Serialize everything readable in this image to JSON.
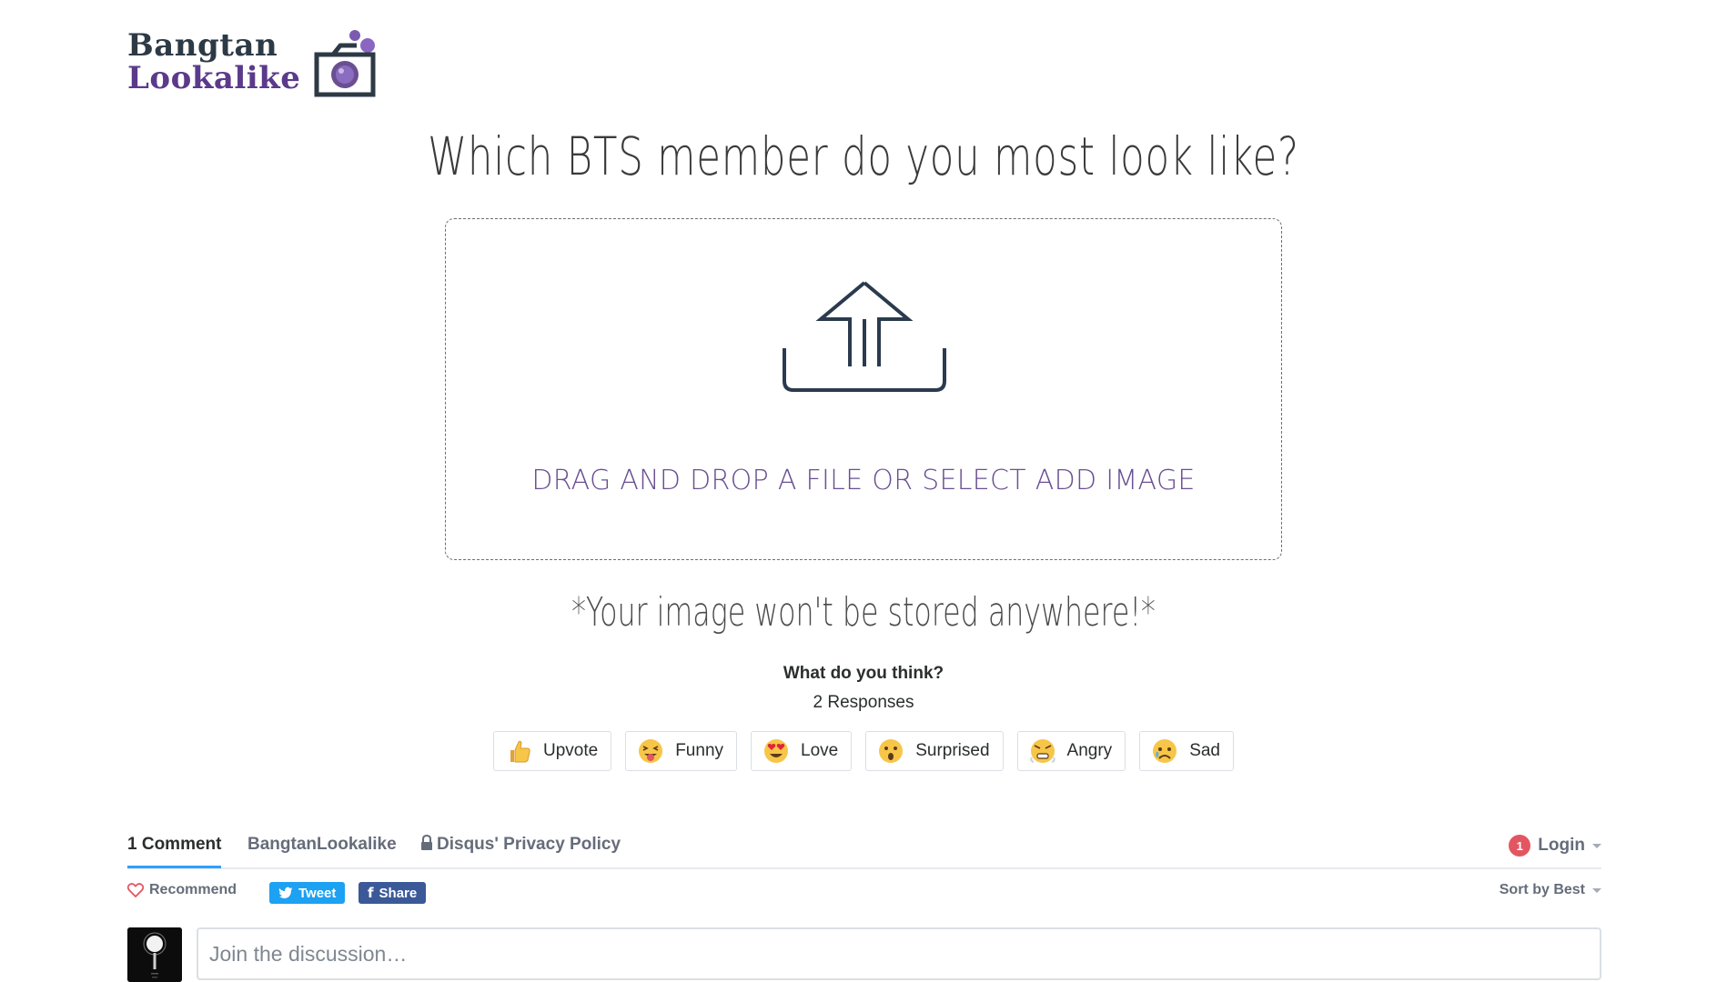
{
  "logo": {
    "line1": "Bangtan",
    "line2": "Lookalike",
    "icon": "camera-icon"
  },
  "headline": "Which BTS member do you most look like?",
  "dropzone": {
    "icon": "upload-tray-icon",
    "text": "DRAG AND DROP A FILE OR SELECT ADD IMAGE"
  },
  "storage_note": "*Your image won't be stored anywhere!*",
  "reactions": {
    "title": "What do you think?",
    "count": "2 Responses",
    "items": [
      {
        "label": "Upvote",
        "icon": "thumbs-up-emoji"
      },
      {
        "label": "Funny",
        "icon": "tongue-out-emoji"
      },
      {
        "label": "Love",
        "icon": "heart-eyes-emoji"
      },
      {
        "label": "Surprised",
        "icon": "surprised-emoji"
      },
      {
        "label": "Angry",
        "icon": "angry-emoji"
      },
      {
        "label": "Sad",
        "icon": "sad-emoji"
      }
    ]
  },
  "disqus": {
    "tabs": {
      "comments": "1 Comment",
      "community": "BangtanLookalike",
      "privacy": "Disqus' Privacy Policy"
    },
    "login": {
      "badge": "1",
      "label": "Login"
    },
    "recommend": "Recommend",
    "tweet": "Tweet",
    "share": "Share",
    "sort": "Sort by Best",
    "input_placeholder": "Join the discussion…"
  },
  "colors": {
    "accent_purple": "#6a4f91",
    "logo_dark": "#2d3a45",
    "twitter": "#1da1f2",
    "facebook": "#3b5998",
    "badge": "#e35661",
    "active_tab": "#2e9fff"
  }
}
